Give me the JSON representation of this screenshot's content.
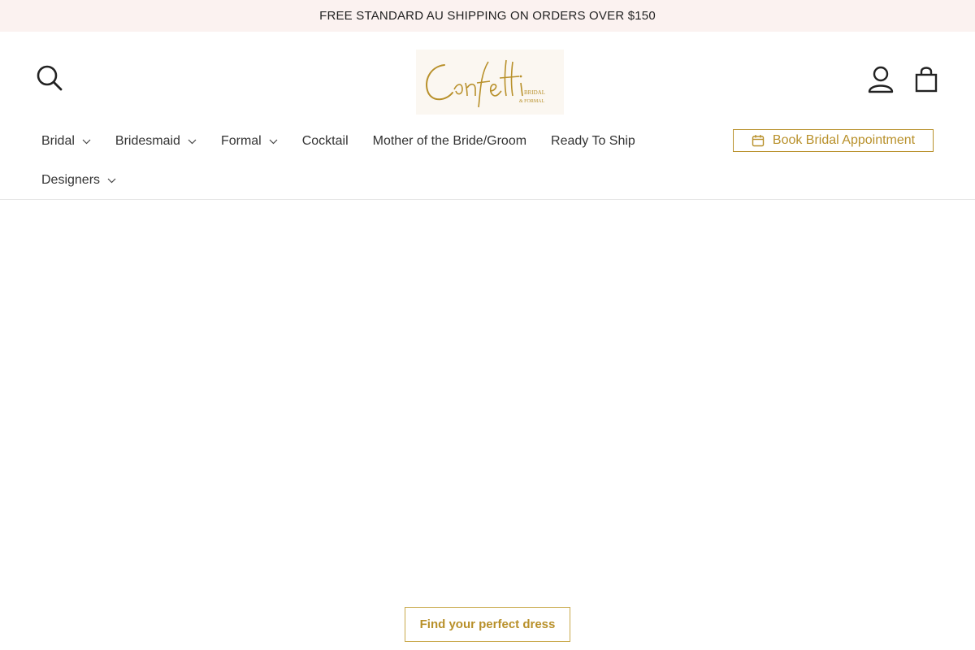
{
  "announcement": {
    "text": "FREE STANDARD AU SHIPPING ON ORDERS OVER $150"
  },
  "header": {
    "logo": {
      "alt": "Confetti Bridal & Formal"
    }
  },
  "nav": {
    "items": [
      {
        "label": "Bridal",
        "has_dropdown": true
      },
      {
        "label": "Bridesmaid",
        "has_dropdown": true
      },
      {
        "label": "Formal",
        "has_dropdown": true
      },
      {
        "label": "Cocktail",
        "has_dropdown": false
      },
      {
        "label": "Mother of the Bride/Groom",
        "has_dropdown": false
      },
      {
        "label": "Ready To Ship",
        "has_dropdown": false
      },
      {
        "label": "Designers",
        "has_dropdown": true
      }
    ],
    "appointment_label": "Book Bridal Appointment"
  },
  "hero": {
    "cta_label": "Find your perfect dress"
  },
  "icons": {
    "search": "search-icon",
    "account": "user-icon",
    "cart": "shopping-bag-icon",
    "calendar": "calendar-icon",
    "chevron": "chevron-down-icon"
  },
  "colors": {
    "announcement_bg": "#fbf2f0",
    "accent_gold": "#b8902a",
    "text": "#333333"
  }
}
